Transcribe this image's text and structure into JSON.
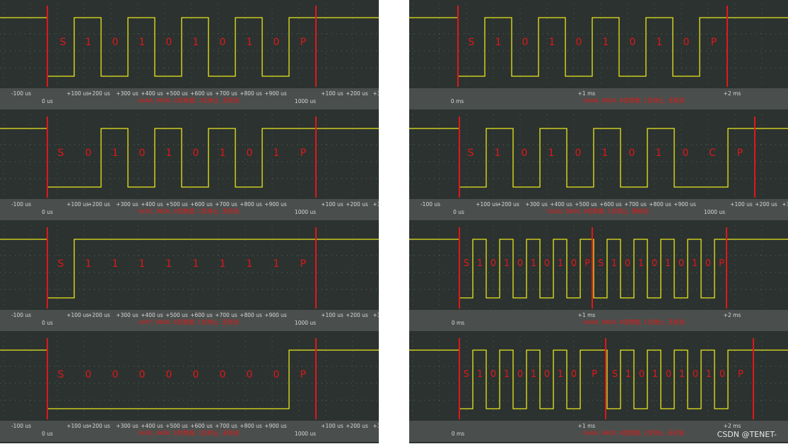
{
  "watermark": "CSDN @TENET-",
  "colors": {
    "background": "#2c3230",
    "trace": "#e8e81a",
    "marker": "#e01818",
    "ruler": "#4a4f4d",
    "grid": "#5a8a70",
    "text": "#d8d8d8"
  },
  "panels": [
    {
      "id": "l1",
      "bits": [
        "S",
        "1",
        "0",
        "1",
        "0",
        "1",
        "0",
        "1",
        "0",
        "P"
      ],
      "caption": "0xAA, 9600, 8位数据, 1位停止, 无校验",
      "ticks": [
        "-100 us",
        "+100 us",
        "+200 us",
        "+300 us",
        "+400 us",
        "+500 us",
        "+600 us",
        "+700 us",
        "+800 us",
        "+900 us",
        "+100 us",
        "+200 us",
        "+3"
      ],
      "ref": [
        "0 us",
        "1000 us"
      ]
    },
    {
      "id": "l2",
      "bits": [
        "S",
        "0",
        "1",
        "0",
        "1",
        "0",
        "1",
        "0",
        "1",
        "P"
      ],
      "caption": "0x55, 9600, 8位数据, 1位停止, 无校验",
      "ticks": [
        "-100 us",
        "+100 us",
        "+200 us",
        "+300 us",
        "+400 us",
        "+500 us",
        "+600 us",
        "+700 us",
        "+800 us",
        "+900 us",
        "+100 us",
        "+200 us",
        "+3"
      ],
      "ref": [
        "0 us",
        "1000 us"
      ]
    },
    {
      "id": "l3",
      "bits": [
        "S",
        "1",
        "1",
        "1",
        "1",
        "1",
        "1",
        "1",
        "1",
        "P"
      ],
      "caption": "0xFF, 9600, 8位数据, 1位停止, 无校验",
      "ticks": [
        "-100 us",
        "+100 us",
        "+200 us",
        "+300 us",
        "+400 us",
        "+500 us",
        "+600 us",
        "+700 us",
        "+800 us",
        "+900 us",
        "+100 us",
        "+200 us",
        "+3"
      ],
      "ref": [
        "0 us",
        "1000 us"
      ]
    },
    {
      "id": "l4",
      "bits": [
        "S",
        "0",
        "0",
        "0",
        "0",
        "0",
        "0",
        "0",
        "0",
        "P"
      ],
      "caption": "0x00, 9600, 8位数据, 1位停止, 无校验",
      "ticks": [
        "-100 us",
        "+100 us",
        "+200 us",
        "+300 us",
        "+400 us",
        "+500 us",
        "+600 us",
        "+700 us",
        "+800 us",
        "+900 us",
        "+100 us",
        "+200 us",
        "+3"
      ],
      "ref": [
        "0 us",
        "1000 us"
      ]
    },
    {
      "id": "r1",
      "bits": [
        "S",
        "1",
        "0",
        "1",
        "0",
        "1",
        "0",
        "1",
        "0",
        "P"
      ],
      "caption": "0xAA, 9600, 8位数据, 1位停止, 无校验",
      "ticks": [
        "+1 ms",
        "+2 ms"
      ],
      "ref": [
        "0 ms"
      ]
    },
    {
      "id": "r2",
      "bits": [
        "S",
        "1",
        "0",
        "1",
        "0",
        "1",
        "0",
        "1",
        "0",
        "C",
        "P"
      ],
      "caption": "0xAA, 9600, 8位数据, 1位停止, 偶校验",
      "ticks": [
        "-100 us",
        "+100 us",
        "+200 us",
        "+300 us",
        "+400 us",
        "+500 us",
        "+600 us",
        "+700 us",
        "+800 us",
        "+900 us",
        "+100 us",
        "+200 us",
        "+3"
      ],
      "ref": [
        "0 us",
        "1000 us"
      ]
    },
    {
      "id": "r3",
      "bits": [
        "S",
        "1",
        "0",
        "1",
        "0",
        "1",
        "0",
        "1",
        "0",
        "P",
        "S",
        "1",
        "0",
        "1",
        "0",
        "1",
        "0",
        "1",
        "0",
        "P"
      ],
      "caption": "0xAA, 9600, 8位数据, 1位停止, 无校验",
      "ticks": [
        "+1 ms",
        "+2 ms"
      ],
      "ref": [
        "0 ms"
      ]
    },
    {
      "id": "r4",
      "bits": [
        "S",
        "1",
        "0",
        "1",
        "0",
        "1",
        "0",
        "1",
        "0",
        "P",
        "S",
        "1",
        "0",
        "1",
        "0",
        "1",
        "0",
        "1",
        "0",
        "P"
      ],
      "caption": "0xAA, 9600, 8位数据, 2位停止, 无校验",
      "ticks": [
        "+1 ms",
        "+2 ms"
      ],
      "ref": [
        "0 ms"
      ]
    }
  ]
}
